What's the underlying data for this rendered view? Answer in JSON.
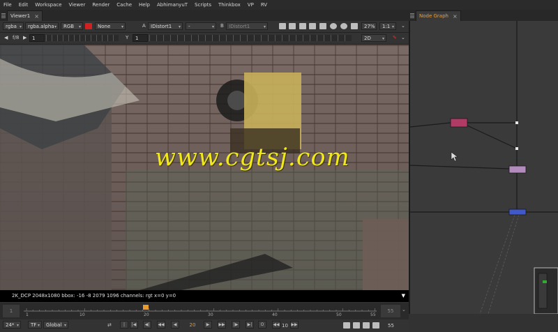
{
  "menu": [
    "File",
    "Edit",
    "Workspace",
    "Viewer",
    "Render",
    "Cache",
    "Help",
    "AbhimanyuT",
    "Scripts",
    "Thinkbox",
    "VP",
    "RV"
  ],
  "viewer_tab": {
    "label": "Viewer1",
    "close": "×"
  },
  "nodegraph_tab": {
    "label": "Node Graph",
    "close": "×"
  },
  "toolbar1": {
    "channels": "rgba",
    "alpha": "rgba.alpha",
    "colorspace": "RGB",
    "lut": "None",
    "input_a_letter": "A",
    "input_a": "IDistort1",
    "wipe": "-",
    "input_b_letter": "B",
    "input_b": "IDistort1",
    "zoom": "27%",
    "ratio": "1:1"
  },
  "toolbar2": {
    "fstop": "f/8",
    "gain": "1",
    "y_label": "Y",
    "gamma": "1",
    "view_mode": "2D"
  },
  "status_text": "2K_DCP 2048x1080  bbox: -16 -8 2079 1096 channels: rgt  x=0 y=0",
  "timeline": {
    "start": "1",
    "end": "55",
    "current_frame_marker": "20",
    "ticks": [
      "1",
      "10",
      "20",
      "30",
      "40",
      "50",
      "55"
    ]
  },
  "controls": {
    "fps": "24*",
    "tf": "TF",
    "range": "Global",
    "frame": "20",
    "step": "10",
    "end_frame": "55"
  },
  "watermark": "www.cgtsj.com",
  "node_colors": {
    "node1": "#b03c66",
    "node2": "#b48bbd",
    "node3": "#4058c8"
  },
  "icons": [
    "grip-icon",
    "close-icon",
    "lut-color-icon",
    "pencil-icon",
    "play-icon",
    "stop-icon",
    "lock-icon",
    "expand-icon"
  ]
}
